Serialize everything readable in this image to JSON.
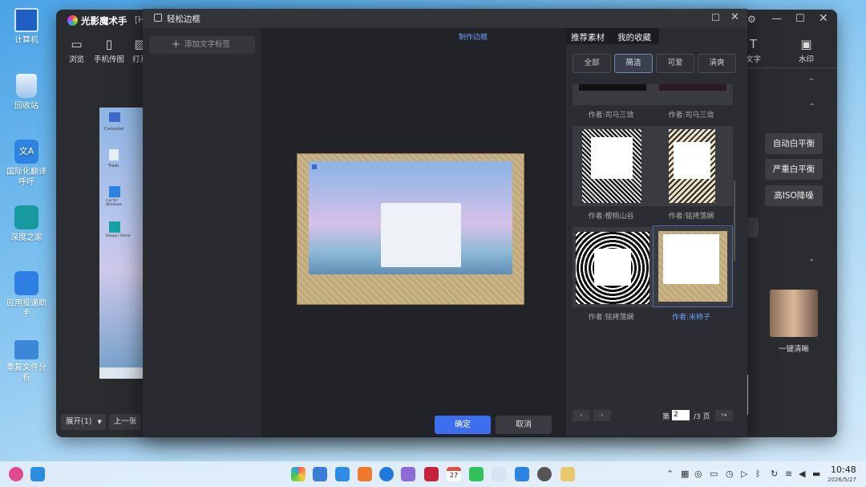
{
  "desktop": {
    "icons": [
      {
        "label": "计算机",
        "color": "#2a6fd6"
      },
      {
        "label": "回收站",
        "color": "#6aa2d8"
      },
      {
        "label": "国际化翻译呼吁",
        "color": "#2d84e0"
      },
      {
        "label": "深度之家",
        "color": "#17a2a6"
      },
      {
        "label": "应用投递助手",
        "color": "#2f7ee6"
      },
      {
        "label": "重复文件分析",
        "color": "#3b87d8"
      }
    ]
  },
  "app": {
    "title": "光影魔术手",
    "title_suffix": "[H",
    "toolbar": [
      "浏览",
      "手机传图",
      "打开"
    ],
    "right_toolbar": [
      "文字",
      "水印"
    ],
    "adjust_buttons": [
      "自动白平衡",
      "严重白平衡",
      "高ISO降噪"
    ],
    "one_key_label": "一键清晰",
    "bottom": {
      "expand": "展开(1)",
      "prev": "上一张"
    }
  },
  "preview": {
    "labels": [
      "Computer",
      "Trash",
      "Cal for Windows",
      "Deepin Home"
    ]
  },
  "dialog": {
    "title": "轻松边框",
    "add_tag": "添加文字标签",
    "make_frame": "制作边框",
    "tabs": [
      "推荐素材",
      "我的收藏"
    ],
    "filters": [
      {
        "label": "全部",
        "selected": false
      },
      {
        "label": "简洁",
        "selected": true
      },
      {
        "label": "可爱",
        "selected": false
      },
      {
        "label": "清爽",
        "selected": false
      }
    ],
    "authors": {
      "row0": [
        "作者:司马三敛",
        "作者:司马三敛"
      ],
      "row1": [
        "作者:樱桃山谷",
        "作者:铭拷落娴"
      ],
      "row2": [
        "作者:铭拷落娴",
        "作者:米柿子"
      ]
    },
    "pager": {
      "prefix": "第",
      "page": "2",
      "suffix": "/3 页",
      "go": "↪"
    },
    "ok": "确定",
    "cancel": "取消"
  },
  "taskbar": {
    "time": "10:48",
    "date": "2026/5/27",
    "calendar_day": "27"
  },
  "colors": {
    "accent": "#3d6ef0",
    "selected_text": "#6ea0ff"
  }
}
